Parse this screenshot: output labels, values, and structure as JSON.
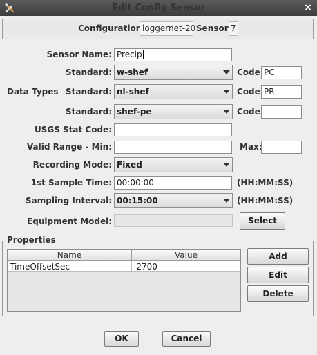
{
  "window": {
    "title": "Edit Config Sensor",
    "close_glyph": "×",
    "tools_icon": "tools-icon"
  },
  "header": {
    "configuration_label": "Configuration:",
    "configuration_value": "loggernet-20",
    "sensor_label": "Sensor:",
    "sensor_value": "7"
  },
  "form": {
    "sensor_name_label": "Sensor Name:",
    "sensor_name_value": "Precip",
    "data_types_label": "Data Types",
    "standard_label": "Standard:",
    "code_label": "Code:",
    "data_types": [
      {
        "standard": "w-shef",
        "code": "PC"
      },
      {
        "standard": "nl-shef",
        "code": "PR"
      },
      {
        "standard": "shef-pe",
        "code": ""
      }
    ],
    "usgs_label": "USGS Stat Code:",
    "usgs_value": "",
    "valid_range_min_label": "Valid Range - Min:",
    "valid_range_min_value": "",
    "valid_range_max_label": "Max:",
    "valid_range_max_value": "",
    "recording_mode_label": "Recording Mode:",
    "recording_mode_value": "Fixed",
    "first_sample_label": "1st Sample Time:",
    "first_sample_value": "00:00:00",
    "time_format_hint": "(HH:MM:SS)",
    "sampling_interval_label": "Sampling Interval:",
    "sampling_interval_value": "00:15:00",
    "equipment_model_label": "Equipment Model:",
    "equipment_model_value": "",
    "select_button": "Select"
  },
  "properties": {
    "legend": "Properties",
    "columns": [
      "Name",
      "Value"
    ],
    "rows": [
      {
        "name": "TimeOffsetSec",
        "value": "-2700"
      }
    ],
    "add_button": "Add",
    "edit_button": "Edit",
    "delete_button": "Delete"
  },
  "footer": {
    "ok_button": "OK",
    "cancel_button": "Cancel"
  }
}
